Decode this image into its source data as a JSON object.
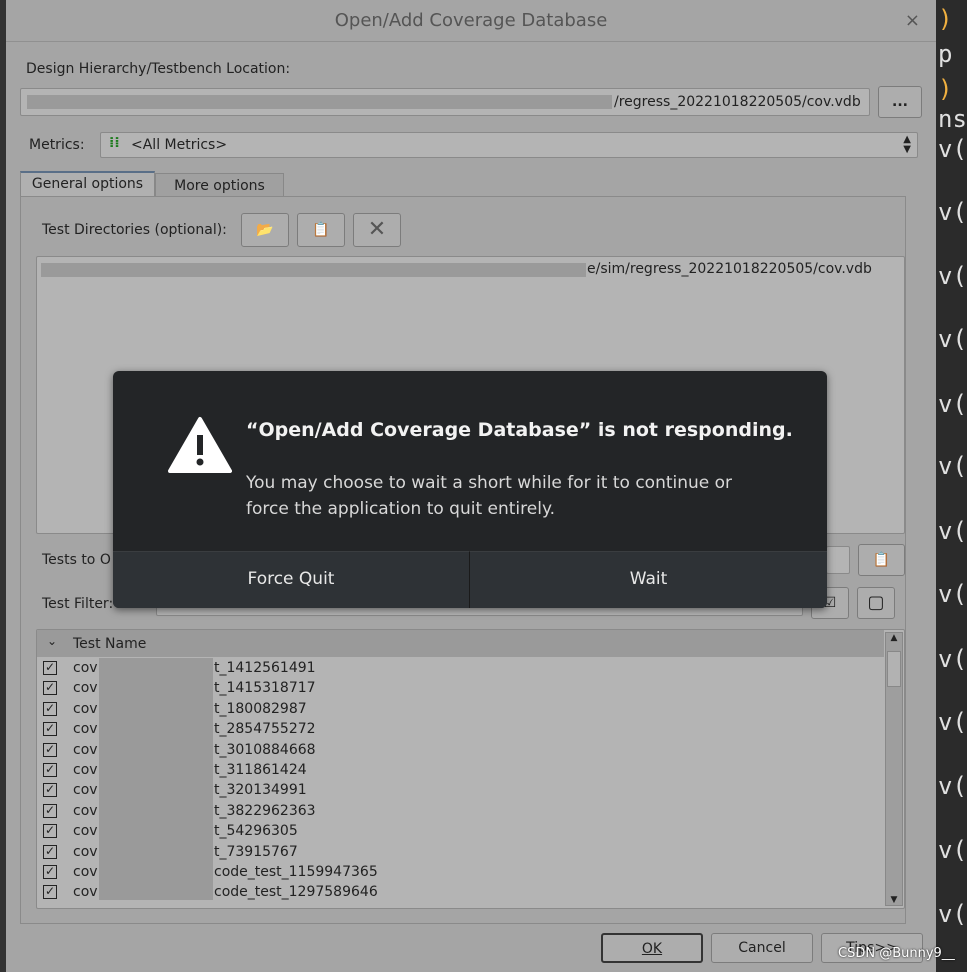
{
  "window": {
    "title": "Open/Add Coverage Database",
    "close_icon": "×"
  },
  "location": {
    "label": "Design Hierarchy/Testbench Location:",
    "value_visible": "/regress_20221018220505/cov.vdb",
    "browse_label": "..."
  },
  "metrics": {
    "label": "Metrics:",
    "value": "<All Metrics>"
  },
  "tabs": [
    {
      "label": "General options",
      "active": true
    },
    {
      "label": "More options",
      "active": false
    }
  ],
  "test_dirs": {
    "label": "Test Directories (optional):",
    "entries_visible": [
      "e/sim/regress_20221018220505/cov.vdb"
    ]
  },
  "tests_to": {
    "label": "Tests to O"
  },
  "test_filter": {
    "label": "Test Filter:"
  },
  "table": {
    "header": "Test Name",
    "rows": [
      {
        "prefix": "cov",
        "suffix": "t_1412561491",
        "checked": true
      },
      {
        "prefix": "cov",
        "suffix": "t_1415318717",
        "checked": true
      },
      {
        "prefix": "cov",
        "suffix": "t_180082987",
        "checked": true
      },
      {
        "prefix": "cov",
        "suffix": "t_2854755272",
        "checked": true
      },
      {
        "prefix": "cov",
        "suffix": "t_3010884668",
        "checked": true
      },
      {
        "prefix": "cov",
        "suffix": "t_311861424",
        "checked": true
      },
      {
        "prefix": "cov",
        "suffix": "t_320134991",
        "checked": true
      },
      {
        "prefix": "cov",
        "suffix": "t_3822962363",
        "checked": true
      },
      {
        "prefix": "cov",
        "suffix": "t_54296305",
        "checked": true
      },
      {
        "prefix": "cov",
        "suffix": "t_73915767",
        "checked": true
      },
      {
        "prefix": "cov",
        "suffix": "code_test_1159947365",
        "checked": true
      },
      {
        "prefix": "cov",
        "suffix": "code_test_1297589646",
        "checked": true
      }
    ]
  },
  "footer": {
    "ok": "OK",
    "cancel": "Cancel",
    "tips": "Tips>>"
  },
  "modal": {
    "title": "“Open/Add Coverage Database” is not responding.",
    "body": "You may choose to wait a short while for it to continue or force the application to quit entirely.",
    "force_quit": "Force Quit",
    "wait": "Wait"
  },
  "watermark": "CSDN @Bunny9__",
  "editor_right": [
    ")",
    "p",
    ")",
    "ns",
    "v(",
    "v(",
    "v(",
    "v(",
    "v(",
    "v(",
    "v(",
    "v(",
    "v(",
    "v(",
    "v(",
    "v(",
    "v("
  ]
}
